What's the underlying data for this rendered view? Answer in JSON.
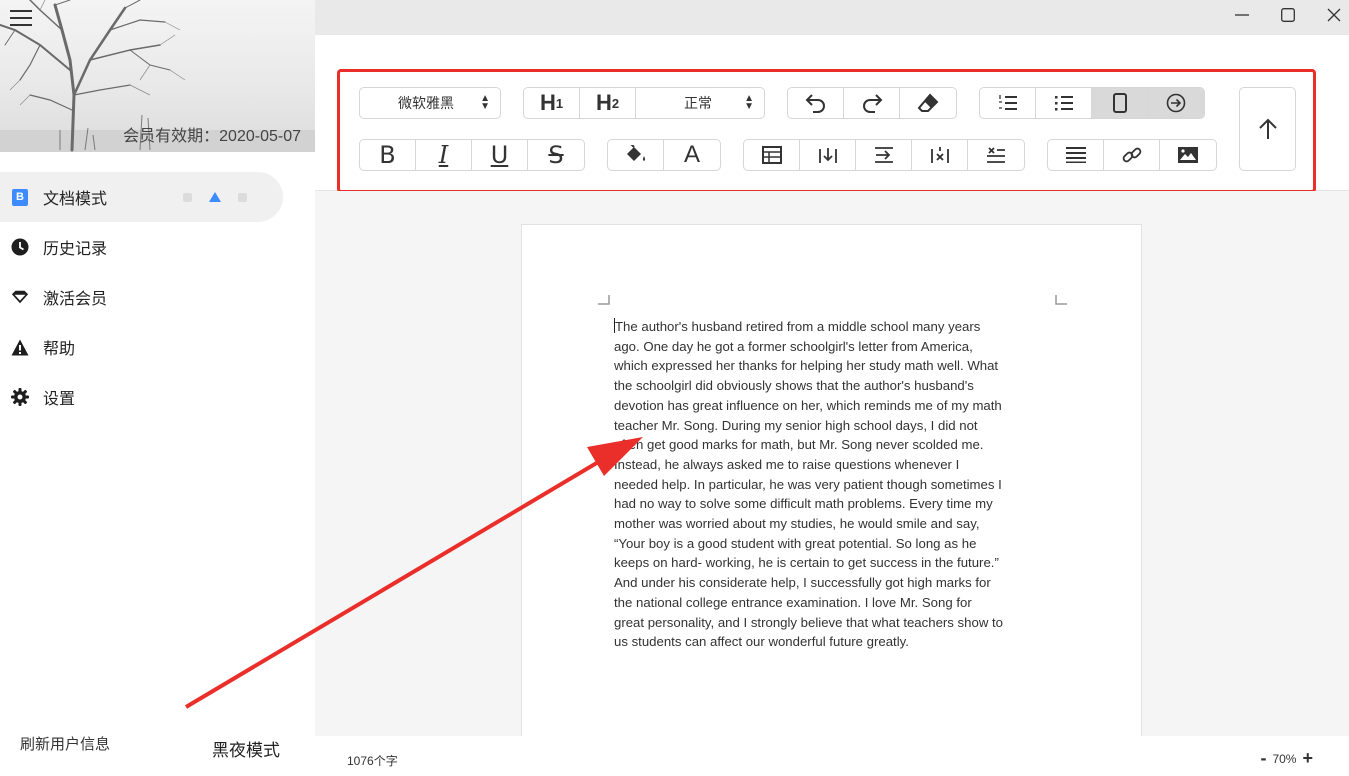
{
  "sidebar": {
    "membership_text": "会员有效期：2020-05-07",
    "nav": [
      {
        "label": "文档模式",
        "icon": "document-b-icon",
        "active": true
      },
      {
        "label": "历史记录",
        "icon": "clock-icon"
      },
      {
        "label": "激活会员",
        "icon": "diamond-icon"
      },
      {
        "label": "帮助",
        "icon": "warning-icon"
      },
      {
        "label": "设置",
        "icon": "gear-icon"
      }
    ],
    "refresh_label": "刷新用户信息",
    "night_mode_label": "黑夜模式"
  },
  "toolbar": {
    "font_select": "微软雅黑",
    "heading1": "H",
    "heading1_sub": "1",
    "heading2": "H",
    "heading2_sub": "2",
    "paragraph_select": "正常",
    "bold": "B",
    "italic": "I",
    "underline": "U",
    "strike": "S",
    "font_color": "A"
  },
  "document": {
    "text": "The author's husband retired from a middle school many years\nago. One day he got a former schoolgirl's letter from America,\nwhich expressed her thanks for helping her study math well. What\nthe schoolgirl did obviously shows that the author's husband's\ndevotion has great influence on her, which reminds me of my math\nteacher Mr. Song. During my senior high school days, I did not\noften get good marks for math, but Mr. Song never scolded me.\nInstead, he always asked me to raise questions whenever I\nneeded help. In particular, he was very patient though sometimes I\nhad no way to solve some difficult math problems. Every time my\nmother was worried about my studies, he would smile and say,\n“Your boy is a good student with great potential. So long as he\nkeeps on hard- working, he is certain to get success in the future.”\nAnd under his considerate help, I successfully got high marks for\nthe national college entrance examination. I love Mr. Song for\ngreat personality, and I strongly believe that what teachers show to\nus students can affect our wonderful future greatly."
  },
  "status": {
    "word_count": "1076个字",
    "zoom_minus": "-",
    "zoom_level": "70%",
    "zoom_plus": "+"
  },
  "colors": {
    "accent": "#3d8bfd",
    "highlight_box": "#ea2e2a",
    "annotation_arrow": "#ea2e2a"
  }
}
